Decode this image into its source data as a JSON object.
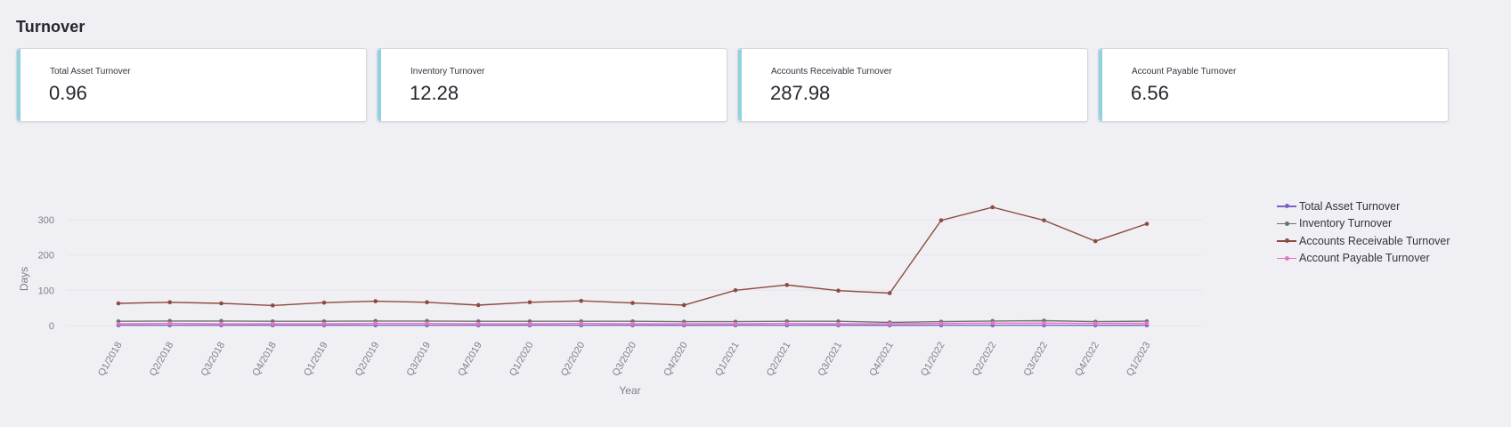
{
  "page": {
    "title": "Turnover"
  },
  "metrics": [
    {
      "label": "Total Asset Turnover",
      "value": "0.96"
    },
    {
      "label": "Inventory Turnover",
      "value": "12.28"
    },
    {
      "label": "Accounts Receivable Turnover",
      "value": "287.98"
    },
    {
      "label": "Account Payable Turnover",
      "value": "6.56"
    }
  ],
  "colors": {
    "card_accent": "#8fd3e0",
    "background": "#f0eff4"
  },
  "chart_data": {
    "type": "line",
    "xlabel": "Year",
    "ylabel": "Days",
    "ylim": [
      -5,
      345
    ],
    "yticks": [
      0,
      100,
      200,
      300
    ],
    "grid": true,
    "legend_position": "right",
    "categories": [
      "Q1/2018",
      "Q2/2018",
      "Q3/2018",
      "Q4/2018",
      "Q1/2019",
      "Q2/2019",
      "Q3/2019",
      "Q4/2019",
      "Q1/2020",
      "Q2/2020",
      "Q3/2020",
      "Q4/2020",
      "Q1/2021",
      "Q2/2021",
      "Q3/2021",
      "Q4/2021",
      "Q1/2022",
      "Q2/2022",
      "Q3/2022",
      "Q4/2022",
      "Q1/2023"
    ],
    "series": [
      {
        "name": "Total Asset Turnover",
        "color": "#7b61c8",
        "values": [
          1.0,
          1.1,
          1.0,
          1.0,
          1.0,
          1.1,
          1.0,
          1.0,
          1.0,
          1.1,
          1.0,
          0.9,
          1.0,
          1.0,
          1.0,
          0.9,
          1.0,
          1.1,
          1.0,
          0.9,
          0.96
        ]
      },
      {
        "name": "Inventory Turnover",
        "color": "#6e6e6e",
        "values": [
          12,
          13,
          13,
          12,
          12,
          13,
          13,
          12,
          12,
          12,
          12,
          11,
          11,
          12,
          12,
          9,
          11,
          13,
          14,
          11,
          12.28
        ]
      },
      {
        "name": "Accounts Receivable Turnover",
        "color": "#8c4b3f",
        "values": [
          63,
          66,
          63,
          57,
          65,
          69,
          66,
          58,
          66,
          70,
          64,
          58,
          100,
          115,
          99,
          92,
          298,
          335,
          298,
          239,
          287.98
        ]
      },
      {
        "name": "Account Payable Turnover",
        "color": "#e377c2",
        "values": [
          5,
          6,
          5,
          5,
          5,
          6,
          6,
          5,
          5,
          6,
          5,
          5,
          5,
          6,
          5,
          5,
          6,
          7,
          7,
          6,
          6.56
        ]
      }
    ]
  }
}
